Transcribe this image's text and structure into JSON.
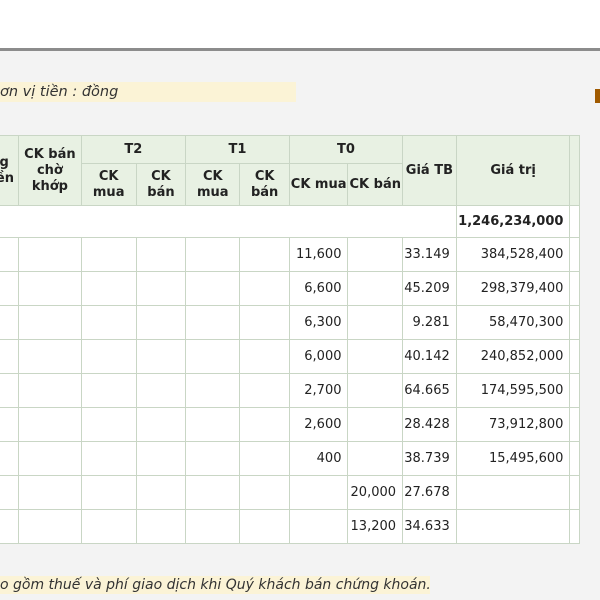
{
  "unit_note": "ơn vị tiền : đồng",
  "footnote": "o gồm thuế và phí giao dịch khi Quý khách bán chứng khoán.",
  "table": {
    "headers": {
      "col_a": "ng tiền",
      "col_b": "CK bán chờ khớp",
      "t2": "T2",
      "t1": "T1",
      "t0": "T0",
      "ck_mua": "CK mua",
      "ck_ban": "CK bán",
      "gia_tb": "Giá TB",
      "gia_tri": "Giá trị"
    },
    "total": "1,246,234,000",
    "rows": [
      {
        "t0_mua": "11,600",
        "t0_ban": "",
        "gia_tb": "33.149",
        "gia_tri": "384,528,400"
      },
      {
        "t0_mua": "6,600",
        "t0_ban": "",
        "gia_tb": "45.209",
        "gia_tri": "298,379,400"
      },
      {
        "t0_mua": "6,300",
        "t0_ban": "",
        "gia_tb": "9.281",
        "gia_tri": "58,470,300"
      },
      {
        "t0_mua": "6,000",
        "t0_ban": "",
        "gia_tb": "40.142",
        "gia_tri": "240,852,000"
      },
      {
        "t0_mua": "2,700",
        "t0_ban": "",
        "gia_tb": "64.665",
        "gia_tri": "174,595,500"
      },
      {
        "t0_mua": "2,600",
        "t0_ban": "",
        "gia_tb": "28.428",
        "gia_tri": "73,912,800"
      },
      {
        "t0_mua": "400",
        "t0_ban": "",
        "gia_tb": "38.739",
        "gia_tri": "15,495,600"
      },
      {
        "t0_mua": "",
        "t0_ban": "20,000",
        "gia_tb": "27.678",
        "gia_tri": ""
      },
      {
        "t0_mua": "",
        "t0_ban": "13,200",
        "gia_tb": "34.633",
        "gia_tri": ""
      }
    ]
  },
  "colors": {
    "header_bg": "#e8f1e3",
    "grid_line": "#c9d6c5",
    "note_bg": "#fbf3d6",
    "panel_bg": "#f3f3f3"
  }
}
